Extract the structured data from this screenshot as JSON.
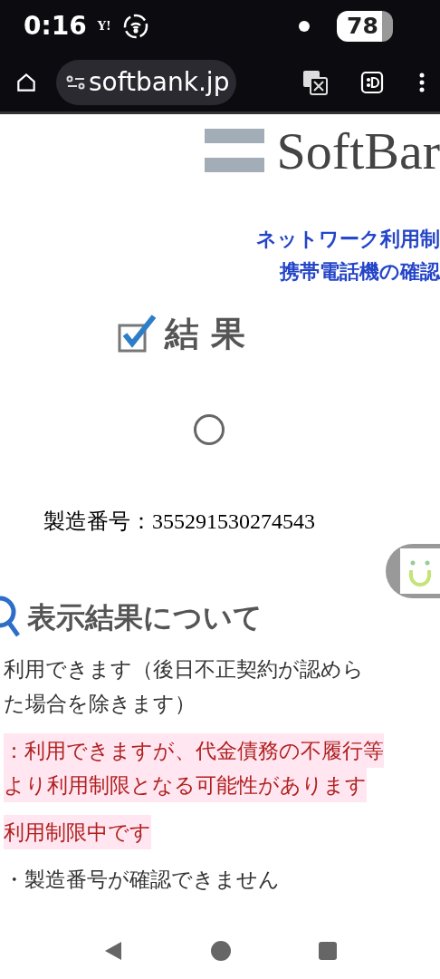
{
  "status_bar": {
    "time": "0:16",
    "carrier_mark": "Y!",
    "battery": "78"
  },
  "browser_bar": {
    "url": "softbank.jp"
  },
  "logo": {
    "text": "SoftBar"
  },
  "headline": [
    "ネットワーク利用制",
    "携帯電話機の確認"
  ],
  "result_heading": {
    "text": "結 果",
    "checked": true
  },
  "serial": "製造番号：355291530274543",
  "legend_heading": "表示結果について",
  "legend": [
    {
      "lines": [
        "利用できます（後日不正契約が認めら",
        "た場合を除きます）"
      ],
      "highlighted": false
    },
    {
      "lines": [
        "：利用できますが、代金債務の不履行等",
        "より利用制限となる可能性があります"
      ],
      "highlighted": true
    },
    {
      "lines": [
        "利用制限中です"
      ],
      "highlighted": true
    },
    {
      "lines": [
        "・製造番号が確認できません"
      ],
      "highlighted": false
    }
  ]
}
